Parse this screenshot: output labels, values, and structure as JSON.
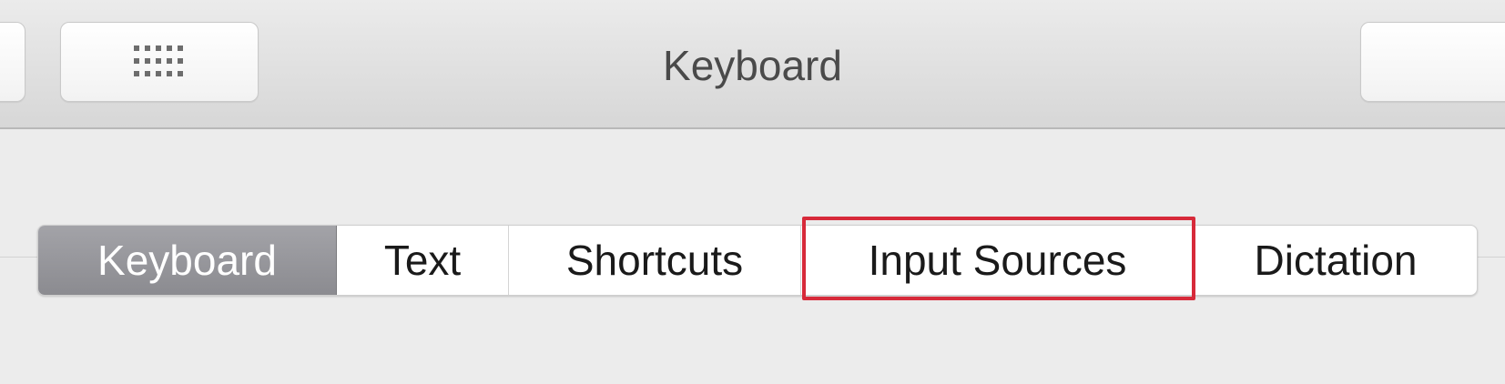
{
  "window": {
    "title": "Keyboard"
  },
  "toolbar": {
    "show_all_icon": "grid-icon"
  },
  "tabs": [
    {
      "label": "Keyboard",
      "selected": true
    },
    {
      "label": "Text",
      "selected": false
    },
    {
      "label": "Shortcuts",
      "selected": false
    },
    {
      "label": "Input Sources",
      "selected": false,
      "highlighted": true
    },
    {
      "label": "Dictation",
      "selected": false
    }
  ],
  "colors": {
    "highlight": "#d72a3a",
    "selected_tab": "#96969b"
  }
}
